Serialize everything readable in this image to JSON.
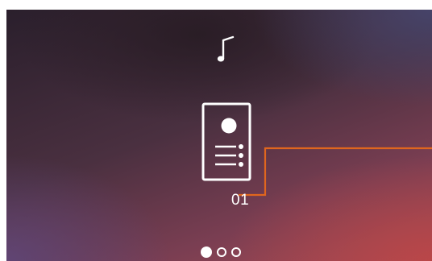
{
  "screen": {
    "music_icon": "music-note-icon",
    "device_icon": "door-entry-panel-icon",
    "device_label": "01",
    "callout_color": "#e0661e"
  },
  "pager": {
    "page_count": 3,
    "active_page": 1
  }
}
